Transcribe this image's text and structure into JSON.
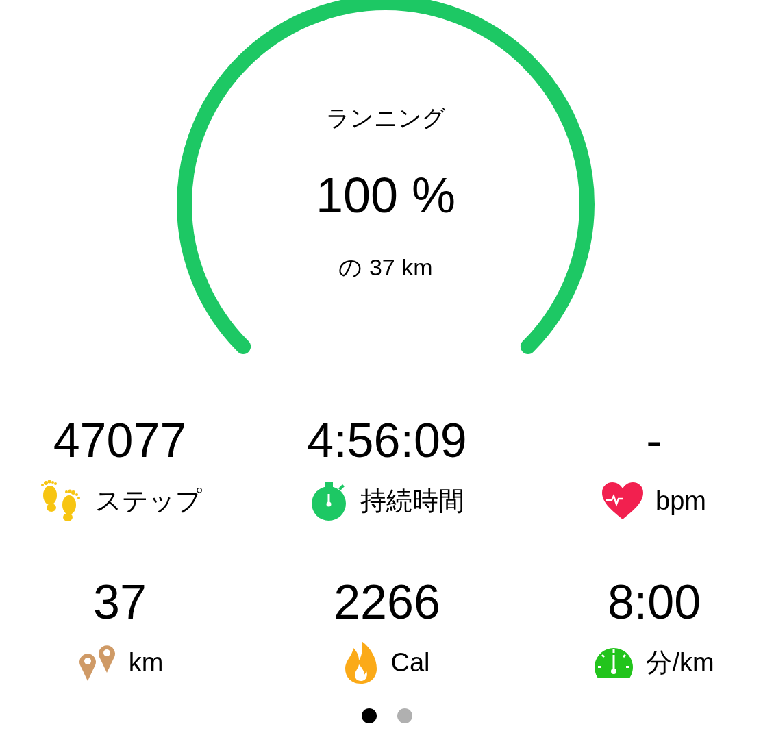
{
  "goal": {
    "activity": "ランニング",
    "percent": "100 %",
    "target": "の 37 km"
  },
  "stats": [
    {
      "kind": "steps",
      "value": "47077",
      "label": "ステップ"
    },
    {
      "kind": "duration",
      "value": "4:56:09",
      "label": "持続時間"
    },
    {
      "kind": "heart",
      "value": "-",
      "label": "bpm"
    },
    {
      "kind": "distance",
      "value": "37",
      "label": "km"
    },
    {
      "kind": "calories",
      "value": "2266",
      "label": "Cal"
    },
    {
      "kind": "pace",
      "value": "8:00",
      "label": "分/km"
    }
  ],
  "pages": [
    {
      "selected": true
    },
    {
      "selected": false
    }
  ]
}
